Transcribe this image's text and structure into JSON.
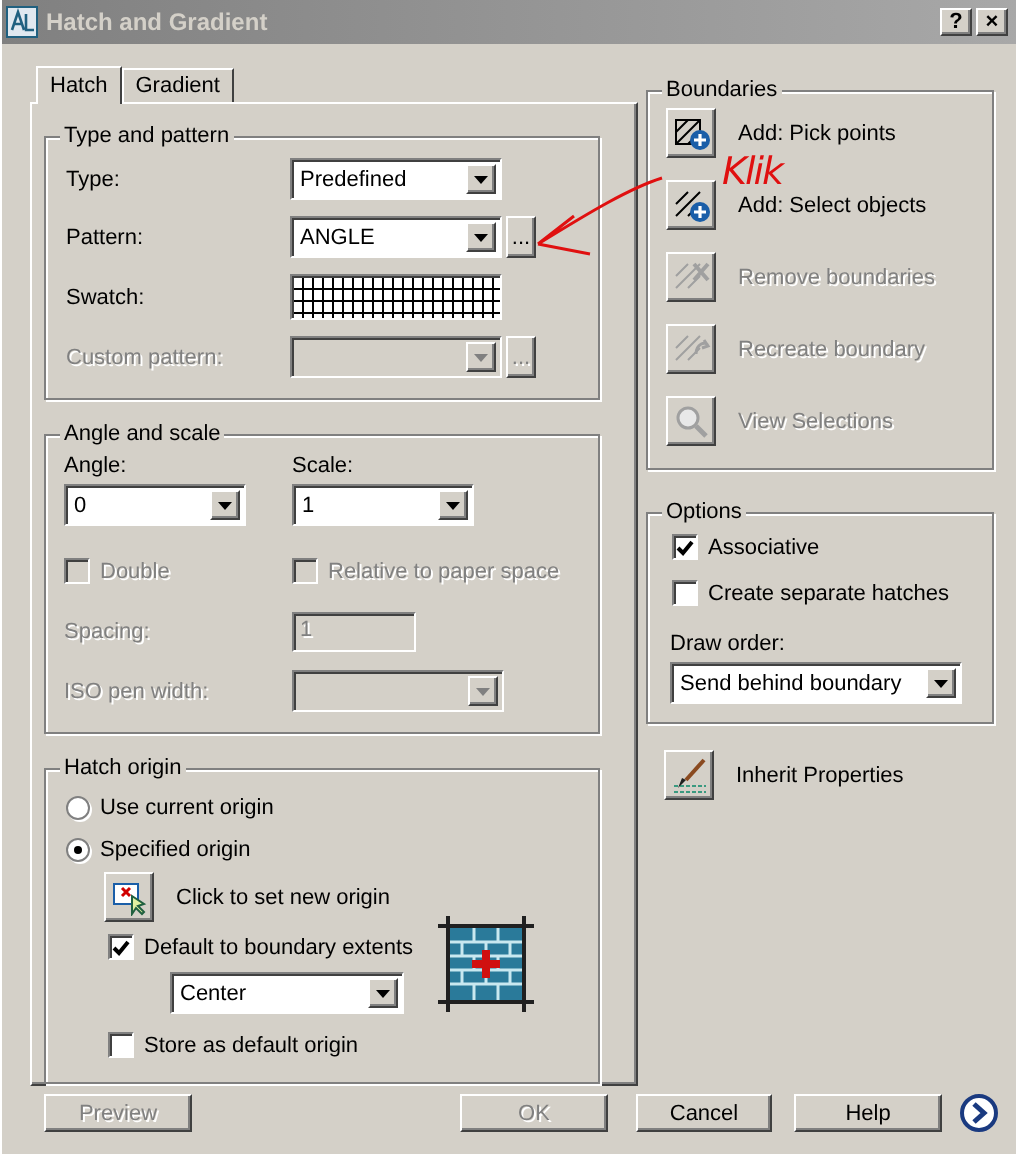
{
  "window": {
    "title": "Hatch and Gradient",
    "help": "?",
    "close": "×"
  },
  "tabs": [
    {
      "label": "Hatch",
      "selected": true
    },
    {
      "label": "Gradient",
      "selected": false
    }
  ],
  "type_and_pattern": {
    "title": "Type and pattern",
    "fields": [
      {
        "kind": "combo",
        "label": "Type:",
        "value": "Predefined",
        "disabled": false
      },
      {
        "kind": "combo_browse",
        "label": "Pattern:",
        "value": "ANGLE",
        "browse": "...",
        "disabled": false
      },
      {
        "kind": "swatch",
        "label": "Swatch:",
        "disabled": false
      },
      {
        "kind": "combo_browse",
        "label": "Custom pattern:",
        "browse": "...",
        "disabled": true
      }
    ]
  },
  "angle_and_scale": {
    "title": "Angle and scale",
    "angle": {
      "label": "Angle:",
      "value": "0"
    },
    "scale": {
      "label": "Scale:",
      "value": "1"
    },
    "double": {
      "label": "Double",
      "checked": false,
      "disabled": true
    },
    "relative": {
      "label": "Relative to paper space",
      "checked": false,
      "disabled": true
    },
    "spacing": {
      "label": "Spacing:",
      "value": "1",
      "disabled": true
    },
    "iso_pen_width": {
      "label": "ISO pen width:",
      "disabled": true
    }
  },
  "hatch_origin": {
    "title": "Hatch origin",
    "origins": [
      {
        "label": "Use current origin",
        "selected": false
      },
      {
        "label": "Specified origin",
        "selected": true
      }
    ],
    "set_origin": {
      "label": "Click to set new origin"
    },
    "default_extents": {
      "label": "Default to boundary extents",
      "checked": true
    },
    "position": {
      "value": "Center"
    },
    "store_default": {
      "label": "Store as default origin",
      "checked": false
    }
  },
  "boundaries": {
    "title": "Boundaries",
    "actions": [
      {
        "kind": "pick",
        "label": "Add: Pick points",
        "disabled": false
      },
      {
        "kind": "select",
        "label": "Add: Select objects",
        "disabled": false
      },
      {
        "kind": "remove",
        "label": "Remove boundaries",
        "disabled": true
      },
      {
        "kind": "recreate",
        "label": "Recreate boundary",
        "disabled": true
      },
      {
        "kind": "view",
        "label": "View Selections",
        "disabled": true
      }
    ]
  },
  "options": {
    "title": "Options",
    "associative": {
      "label": "Associative",
      "checked": true
    },
    "separate": {
      "label": "Create separate hatches",
      "checked": false
    },
    "draw_order": {
      "label": "Draw order:",
      "value": "Send behind boundary"
    }
  },
  "inherit": {
    "label": "Inherit Properties"
  },
  "buttons": [
    {
      "label": "Preview",
      "disabled": true
    },
    {
      "label": "OK",
      "disabled": true
    },
    {
      "label": "Cancel",
      "disabled": false
    },
    {
      "label": "Help",
      "disabled": false
    }
  ],
  "annotation": {
    "text": "Klik"
  }
}
